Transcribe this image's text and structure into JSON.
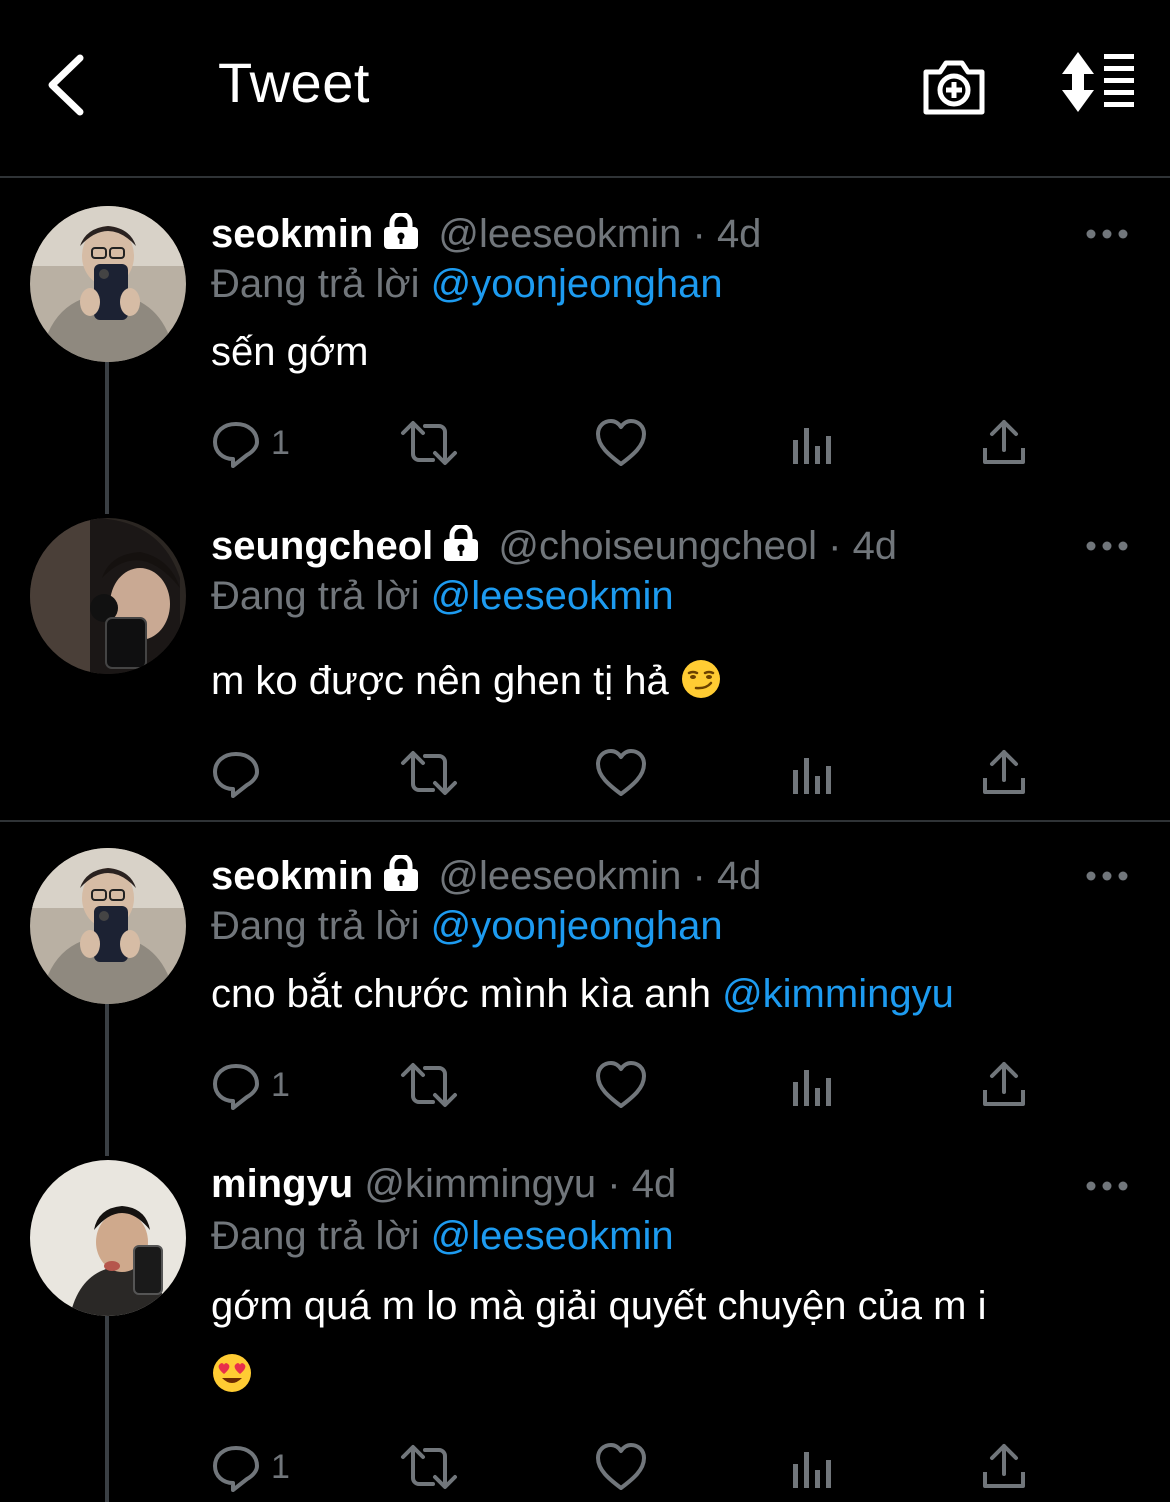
{
  "header": {
    "title": "Tweet"
  },
  "reply_prefix": "Đang trả lời",
  "tweets": [
    {
      "name": "seokmin",
      "handle": "@leeseokmin",
      "sep": "·",
      "time": "4d",
      "replying_to": "@yoonjeonghan",
      "text": "sến gớm",
      "mention": "",
      "reply_count": "1"
    },
    {
      "name": "seungcheol",
      "handle": "@choiseungcheol",
      "sep": "·",
      "time": "4d",
      "replying_to": "@leeseokmin",
      "text": "m ko được nên ghen tị hả",
      "mention": "",
      "reply_count": ""
    },
    {
      "name": "seokmin",
      "handle": "@leeseokmin",
      "sep": "·",
      "time": "4d",
      "replying_to": "@yoonjeonghan",
      "text": "cno bắt chước mình kìa anh ",
      "mention": "@kimmingyu",
      "reply_count": "1"
    },
    {
      "name": "mingyu",
      "handle": "@kimmingyu",
      "sep": "·",
      "time": "4d",
      "replying_to": "@leeseokmin",
      "text": "gớm quá m lo mà giải quyết chuyện của m i",
      "mention": "",
      "reply_count": "1"
    }
  ],
  "icons": [
    "back-icon",
    "camera-plus-icon",
    "sort-icon",
    "lock-icon",
    "more-icon",
    "reply-icon",
    "retweet-icon",
    "like-icon",
    "analytics-icon",
    "share-icon",
    "smirk-emoji",
    "heart-eyes-emoji"
  ],
  "colors": {
    "background": "#000000",
    "accent": "#1d9bf0",
    "muted": "#71767b",
    "divider": "#2f3336"
  }
}
